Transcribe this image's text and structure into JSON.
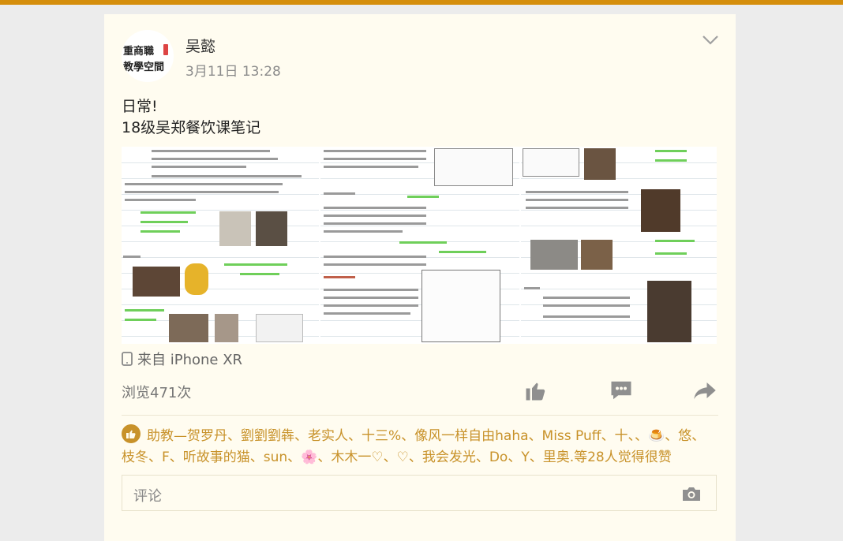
{
  "colors": {
    "accent": "#d58e0c",
    "like_text": "#c8922a"
  },
  "post": {
    "avatar_line1": "重商職",
    "avatar_line2": "教學空間",
    "author": "吴懿",
    "time": "3月11日 13:28",
    "content_line1": "日常!",
    "content_line2": "18级吴郑餐饮课笔记",
    "device": "来自 iPhone XR",
    "views": "浏览471次"
  },
  "icons": {
    "expand": "chevron-down-icon",
    "device": "phone-icon",
    "like": "thumb-up-icon",
    "comment": "comment-icon",
    "share": "share-icon",
    "camera": "camera-icon"
  },
  "likes": {
    "text": "助教—贺罗丹、劉劉劉犇、老实人、十三%、像风一样自由haha、Miss Puff、十、、🍮、悠、枝冬、F、听故事的猫、sun、🌸、木木一♡、♡、我会发光、Do、Y、里奥.等28人觉得很赞"
  },
  "comment": {
    "placeholder": "评论"
  }
}
